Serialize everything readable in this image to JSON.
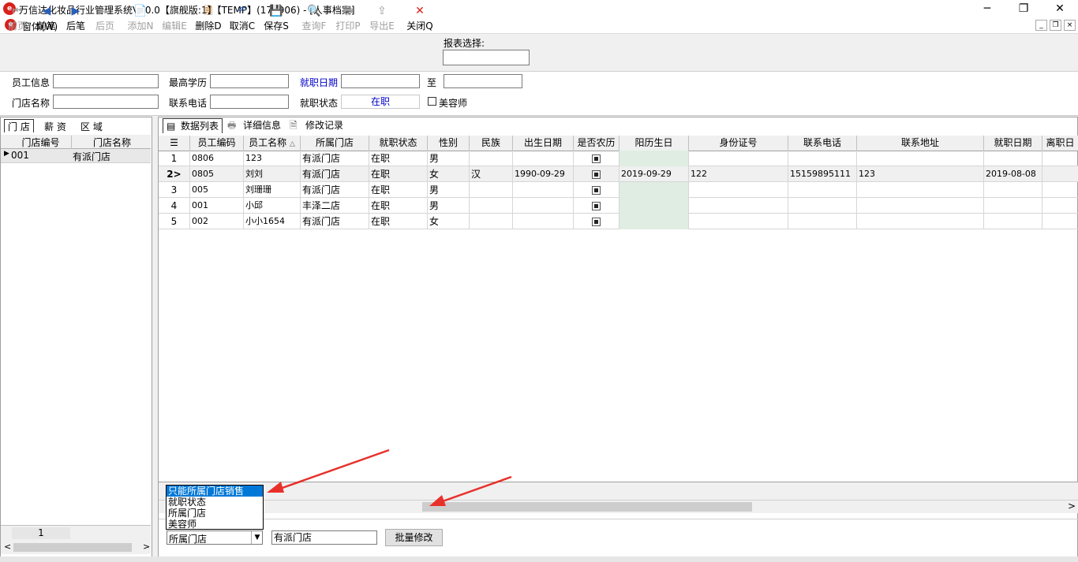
{
  "window": {
    "title": "万信达化妆品行业管理系统V10.0【旗舰版:1】【TEMP】(170906) - [人事档案]",
    "min": "─",
    "max": "❐",
    "close": "✕"
  },
  "menu": {
    "window_menu": "窗体(W)",
    "mdi_min": "_",
    "mdi_restore": "❐",
    "mdi_close": "×"
  },
  "toolbar": {
    "items": [
      {
        "label": "前页",
        "icon": "⏮"
      },
      {
        "label": "前笔",
        "icon": "◀"
      },
      {
        "label": "后笔",
        "icon": "▶"
      },
      {
        "label": "后页",
        "icon": "⏭"
      },
      {
        "label": "添加N",
        "icon": "📄"
      },
      {
        "label": "编辑E",
        "icon": "✎"
      },
      {
        "label": "删除D",
        "icon": "🗎"
      },
      {
        "label": "取消C",
        "icon": "↶"
      },
      {
        "label": "保存S",
        "icon": "💾"
      },
      {
        "label": "查询F",
        "icon": "🔍"
      },
      {
        "label": "打印P",
        "icon": "🖶"
      },
      {
        "label": "导出E",
        "icon": "⇪"
      },
      {
        "label": "关闭Q",
        "icon": "✕"
      }
    ],
    "report_label": "报表选择:"
  },
  "filters": {
    "employee_info_label": "员工信息",
    "education_label": "最高学历",
    "hire_date_label": "就职日期",
    "to_label": "至",
    "store_name_label": "门店名称",
    "phone_label": "联系电话",
    "status_label": "就职状态",
    "status_value": "在职",
    "beautician_label": "美容师"
  },
  "left_panel": {
    "tabs": [
      "门 店",
      "薪 资",
      "区 域"
    ],
    "headers": [
      "门店编号",
      "门店名称"
    ],
    "rows": [
      {
        "code": "001",
        "name": "有派门店"
      }
    ],
    "pager": "1",
    "scroll_left": "<",
    "scroll_right": ">"
  },
  "right_panel": {
    "tabs": [
      "数据列表",
      "详细信息",
      "修改记录"
    ],
    "headers": [
      "员工编码",
      "员工名称",
      "所属门店",
      "就职状态",
      "性别",
      "民族",
      "出生日期",
      "是否农历",
      "阳历生日",
      "身份证号",
      "联系电话",
      "联系地址",
      "就职日期",
      "离职日"
    ],
    "rows": [
      {
        "idx": "1",
        "code": "0806",
        "name": "123",
        "store": "有派门店",
        "status": "在职",
        "gender": "男",
        "nation": "",
        "birth": "",
        "solar": "",
        "id": "",
        "phone": "",
        "addr": "",
        "hire": ""
      },
      {
        "idx": "2>",
        "code": "0805",
        "name": "刘刘",
        "store": "有派门店",
        "status": "在职",
        "gender": "女",
        "nation": "汉",
        "birth": "1990-09-29",
        "solar": "2019-09-29",
        "id": "122",
        "phone": "15159895111",
        "addr": "123",
        "hire": "2019-08-08"
      },
      {
        "idx": "3",
        "code": "005",
        "name": "刘珊珊",
        "store": "有派门店",
        "status": "在职",
        "gender": "男",
        "nation": "",
        "birth": "",
        "solar": "",
        "id": "",
        "phone": "",
        "addr": "",
        "hire": ""
      },
      {
        "idx": "4",
        "code": "001",
        "name": "小邱",
        "store": "丰泽二店",
        "status": "在职",
        "gender": "男",
        "nation": "",
        "birth": "",
        "solar": "",
        "id": "",
        "phone": "",
        "addr": "",
        "hire": ""
      },
      {
        "idx": "5",
        "code": "002",
        "name": "小小1654",
        "store": "有派门店",
        "status": "在职",
        "gender": "女",
        "nation": "",
        "birth": "",
        "solar": "",
        "id": "",
        "phone": "",
        "addr": "",
        "hire": ""
      }
    ],
    "scroll_right": ">"
  },
  "batch": {
    "dropdown_options": [
      "只能所属门店销售",
      "就职状态",
      "所属门店",
      "美容师"
    ],
    "select_value": "所属门店",
    "value": "有派门店",
    "button": "批量修改"
  }
}
